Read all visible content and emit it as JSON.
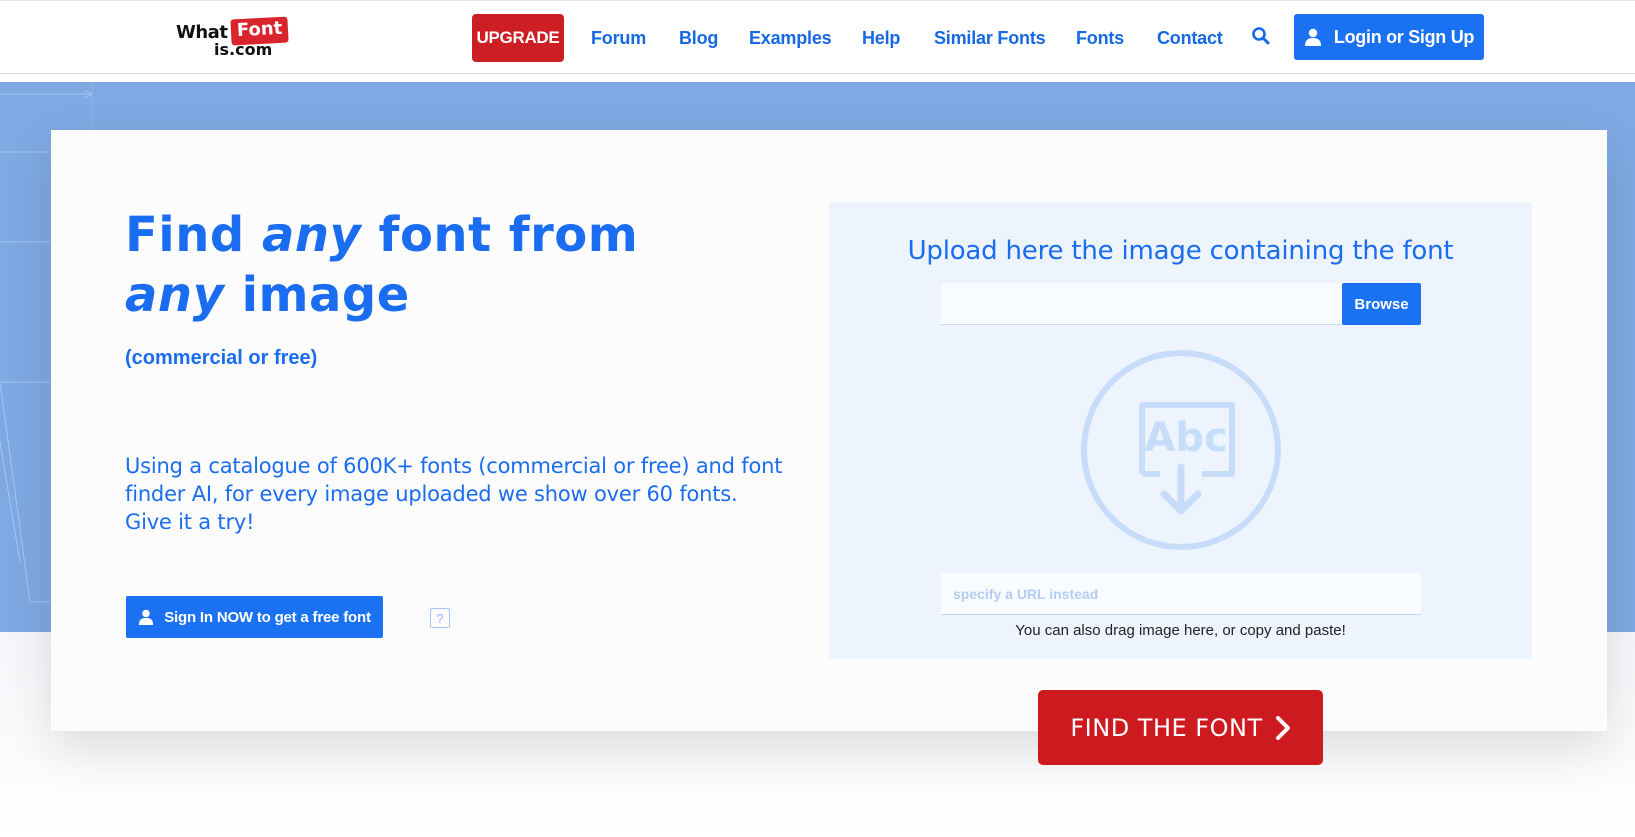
{
  "header": {
    "logo": {
      "line1": "What",
      "badge": "Font",
      "line2": "is.com"
    },
    "upgrade_label": "UPGRADE",
    "nav": [
      {
        "label": "Forum"
      },
      {
        "label": "Blog"
      },
      {
        "label": "Examples"
      },
      {
        "label": "Help"
      },
      {
        "label": "Similar Fonts"
      },
      {
        "label": "Fonts"
      },
      {
        "label": "Contact"
      }
    ],
    "search_icon": "search-icon",
    "login_label": "Login or Sign Up"
  },
  "hero": {
    "title_part1": "Find ",
    "title_em1": "any",
    "title_part2": " font from ",
    "title_em2": "any",
    "title_part3": " image",
    "subtitle": "(commercial or free)",
    "description": "Using a catalogue of 600K+ fonts (commercial or free) and font finder AI, for every image uploaded we show over 60 fonts. Give it a try!",
    "signin_label": "Sign In NOW to get a free font",
    "help_label": "?"
  },
  "upload": {
    "title": "Upload here the image containing the font",
    "browse_label": "Browse",
    "illustration_text": "Abc",
    "url_placeholder": "specify a URL instead",
    "drag_hint": "You can also drag image here, or copy and paste!",
    "find_label": "FIND THE FONT"
  },
  "colors": {
    "brand_blue": "#1a72f2",
    "text_blue": "#1a6cf0",
    "brand_red": "#cc1e23",
    "hero_bg": "#7fa9e3",
    "panel_bg": "#edf4fe"
  }
}
